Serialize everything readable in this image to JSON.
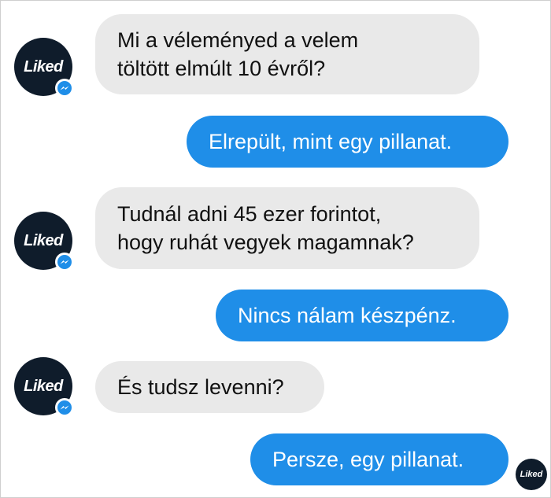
{
  "contact": {
    "avatar_text": "Liked",
    "avatar_icon": "messenger-icon"
  },
  "messages": [
    {
      "side": "in",
      "lines": [
        "Mi a véleményed a velem",
        "töltött elmúlt 10 évről?"
      ]
    },
    {
      "side": "out",
      "text": "Elrepült, mint egy pillanat."
    },
    {
      "side": "in",
      "lines": [
        "Tudnál adni 45 ezer forintot,",
        "hogy ruhát vegyek magamnak?"
      ]
    },
    {
      "side": "out",
      "text": "Nincs nálam készpénz."
    },
    {
      "side": "in",
      "text": "És tudsz levenni?"
    },
    {
      "side": "out",
      "text": "Persze, egy pillanat."
    }
  ],
  "colors": {
    "incoming_bubble": "#e9e9e9",
    "outgoing_bubble": "#1f8ee8",
    "avatar_bg": "#0f1c2b",
    "messenger_blue": "#1f8ee8"
  }
}
